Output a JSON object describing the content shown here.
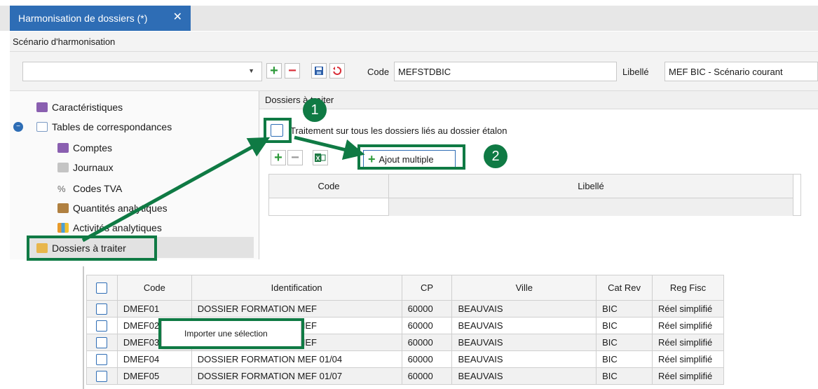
{
  "tab": {
    "title": "Harmonisation de dossiers (*)",
    "close_glyph": "✕"
  },
  "scenario": {
    "section_title": "Scénario d'harmonisation",
    "combo_value": "",
    "code_label": "Code",
    "code_value": "MEFSTDBIC",
    "libelle_label": "Libellé",
    "libelle_value": "MEF BIC - Scénario courant"
  },
  "tree": {
    "items": [
      {
        "label": "Caractéristiques",
        "icon": "purple-tag-icon"
      },
      {
        "label": "Tables de correspondances",
        "icon": "table-icon"
      },
      {
        "label": "Comptes",
        "icon": "purple-tag-icon"
      },
      {
        "label": "Journaux",
        "icon": "journal-icon"
      },
      {
        "label": "Codes TVA",
        "icon": "percent-icon"
      },
      {
        "label": "Quantités analytiques",
        "icon": "weight-icon"
      },
      {
        "label": "Activités analytiques",
        "icon": "activity-icon"
      },
      {
        "label": "Dossiers à traiter",
        "icon": "folder-icon"
      }
    ]
  },
  "right": {
    "header": "Dossiers à traiter",
    "checkbox_label": "Traitement sur tous les dossiers liés au dossier étalon",
    "ajout_label": "Ajout multiple",
    "columns": [
      "Code",
      "Libellé"
    ]
  },
  "badges": [
    "1",
    "2"
  ],
  "bottom_table": {
    "columns": [
      "Code",
      "Identification",
      "CP",
      "Ville",
      "Cat Rev",
      "Reg Fisc"
    ],
    "rows": [
      [
        "DMEF01",
        "DOSSIER FORMATION MEF",
        "60000",
        "BEAUVAIS",
        "BIC",
        "Réel simplifié"
      ],
      [
        "DMEF02",
        "DOSSIER FORMATION MEF",
        "60000",
        "BEAUVAIS",
        "BIC",
        "Réel simplifié"
      ],
      [
        "DMEF03",
        "DOSSIER FORMATION MEF",
        "60000",
        "BEAUVAIS",
        "BIC",
        "Réel simplifié"
      ],
      [
        "DMEF04",
        "DOSSIER FORMATION MEF 01/04",
        "60000",
        "BEAUVAIS",
        "BIC",
        "Réel simplifié"
      ],
      [
        "DMEF05",
        "DOSSIER FORMATION MEF 01/07",
        "60000",
        "BEAUVAIS",
        "BIC",
        "Réel simplifié"
      ]
    ]
  },
  "context_menu": {
    "item": "Importer une sélection"
  },
  "colors": {
    "accent": "#2e6db5",
    "callout": "#0f7a44",
    "add": "#2e9a3a",
    "remove": "#d9303a"
  }
}
